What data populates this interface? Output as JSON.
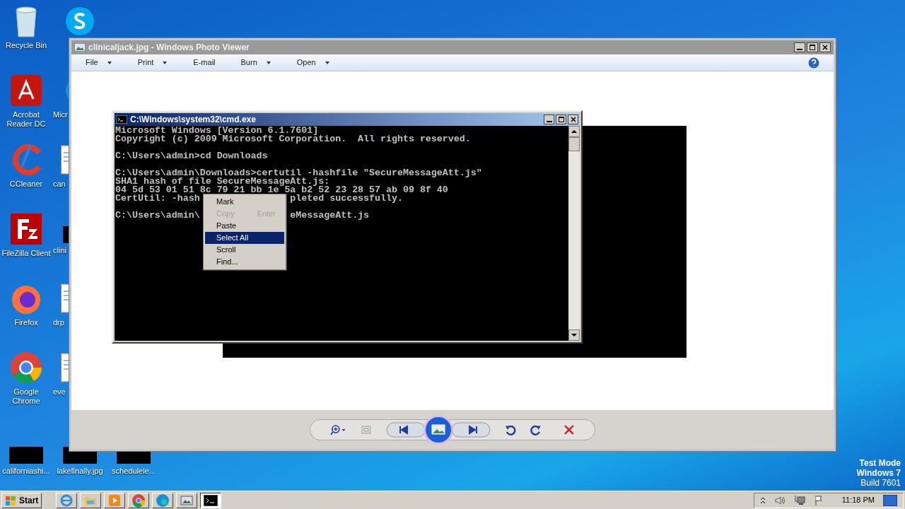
{
  "desktop_icons": [
    {
      "label": "Recycle Bin",
      "kind": "recycle"
    },
    {
      "label": "Acrobat Reader DC",
      "kind": "acrobat"
    },
    {
      "label": "CCleaner",
      "kind": "ccleaner"
    },
    {
      "label": "FileZilla Client",
      "kind": "filezilla"
    },
    {
      "label": "Firefox",
      "kind": "firefox"
    },
    {
      "label": "Google Chrome",
      "kind": "chrome"
    },
    {
      "label": "californiashi...",
      "kind": "thumb"
    },
    {
      "kind": "skype"
    },
    {
      "label": "Micr",
      "kind": "edge"
    },
    {
      "label": "can",
      "kind": "doc"
    },
    {
      "label": "clini",
      "kind": "thumb"
    },
    {
      "label": "drp",
      "kind": "doc"
    },
    {
      "label": "eve",
      "kind": "doc"
    },
    {
      "label": "lakefinally.jpg",
      "kind": "thumb"
    },
    {
      "label": "schedulele...",
      "kind": "thumb"
    }
  ],
  "photo_viewer": {
    "title": "clinicaljack.jpg - Windows Photo Viewer",
    "menu": [
      {
        "label": "File",
        "dropdown": true
      },
      {
        "label": "Print",
        "dropdown": true
      },
      {
        "label": "E-mail",
        "dropdown": false
      },
      {
        "label": "Burn",
        "dropdown": true
      },
      {
        "label": "Open",
        "dropdown": true
      }
    ]
  },
  "cmd": {
    "title": "C:\\Windows\\system32\\cmd.exe",
    "blocks": [
      {
        "lines": [
          {
            "text": "Microsoft Windows [Version 6.1.7601]"
          },
          {
            "text": "Copyright (c) 2009 Microsoft Corporation.  All rights reserved."
          }
        ]
      },
      {
        "lines": [
          {
            "text": "C:\\Users\\admin>cd Downloads"
          }
        ]
      },
      {
        "lines": [
          {
            "text": "C:\\Users\\admin\\Downloads>certutil -hashfile \"SecureMessageAtt.js\""
          },
          {
            "text": "SHA1 hash of file SecureMessageAtt.js:"
          },
          {
            "text": "04 5d 53 01 51 8c 79 21 bb 1e 5a b2 52 23 28 57 ab 09 8f 40"
          },
          {
            "text": "CertUtil: -hash",
            "rest": "pleted successfully."
          }
        ]
      },
      {
        "lines": [
          {
            "text": "C:\\Users\\admin\\",
            "rest": "eMessageAtt.js"
          }
        ]
      }
    ],
    "context_menu": [
      {
        "label": "Mark",
        "disabled": false,
        "selected": false
      },
      {
        "label": "Copy",
        "shortcut": "Enter",
        "disabled": true,
        "selected": false
      },
      {
        "label": "Paste",
        "disabled": false,
        "selected": false
      },
      {
        "label": "Select All",
        "disabled": false,
        "selected": true
      },
      {
        "label": "Scroll",
        "disabled": false,
        "selected": false
      },
      {
        "label": "Find...",
        "disabled": false,
        "selected": false
      }
    ]
  },
  "os_notice": [
    "Test Mode",
    "Windows 7",
    "Build 7601"
  ],
  "taskbar": {
    "start": "Start",
    "items": [
      {
        "kind": "ie",
        "selected": false
      },
      {
        "kind": "explorer",
        "selected": false
      },
      {
        "kind": "media",
        "selected": false
      },
      {
        "kind": "chrome",
        "selected": false
      },
      {
        "kind": "edge",
        "selected": false
      },
      {
        "kind": "photo",
        "selected": false
      },
      {
        "kind": "cmd",
        "selected": true
      }
    ],
    "clock": "11:18 PM"
  }
}
